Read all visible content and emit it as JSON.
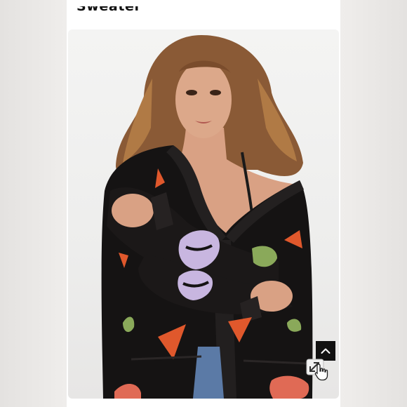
{
  "product": {
    "title": "Sweater"
  },
  "image": {
    "description_icon": "product-photo"
  },
  "controls": {
    "back_to_top_icon": "chevron-up-icon",
    "zoom_icon": "expand-arrows-icon",
    "cursor_icon": "hand-pointer-icon"
  },
  "colors": {
    "background": "#efedeb",
    "page": "#ffffff",
    "sweater": "#151313",
    "heart_orange": "#e0582c",
    "lips_lavender": "#c8b6e0",
    "heart_green": "#8aa95a",
    "lips_red": "#e06a55"
  }
}
